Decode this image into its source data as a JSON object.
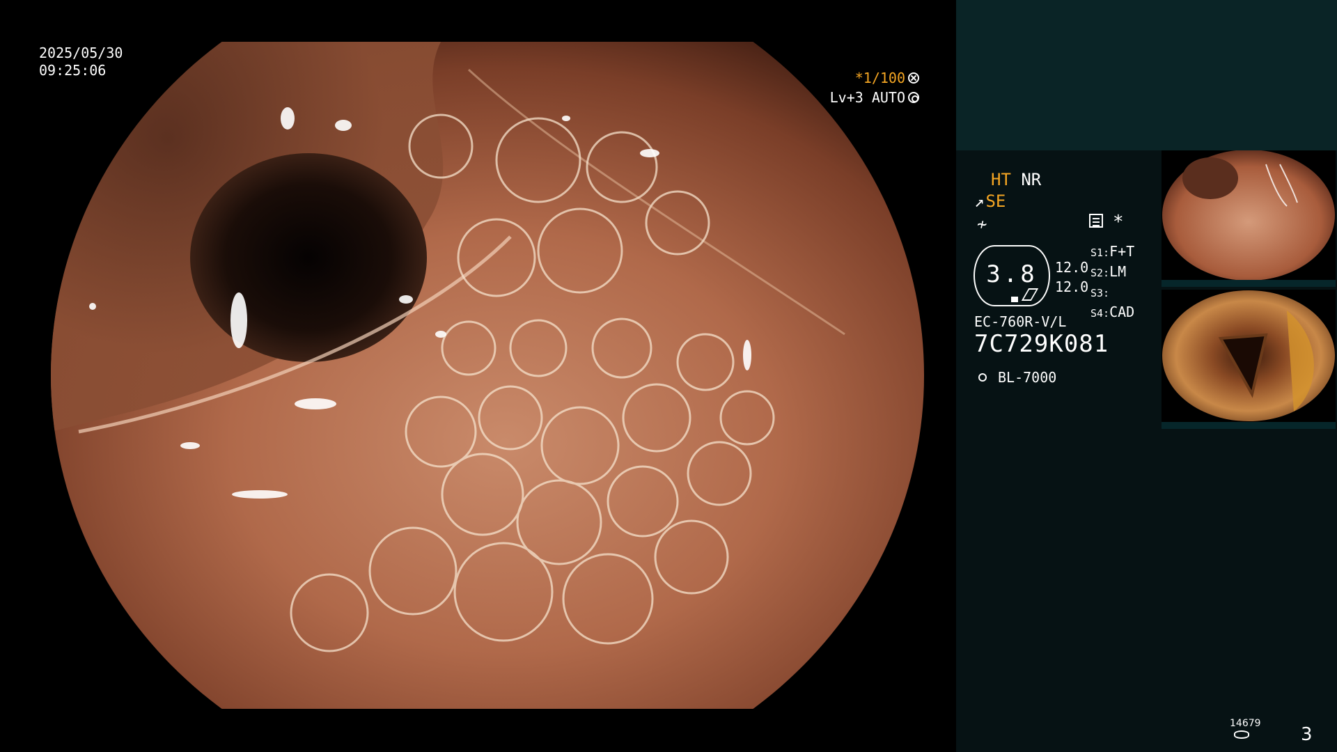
{
  "overlay": {
    "date": "2025/05/30",
    "time": "09:25:06",
    "shutter": "*1/100",
    "exposure": "Lv+3 AUTO"
  },
  "panel": {
    "mode_ht": "HT",
    "mode_nr": "NR",
    "mode_se": "SE",
    "zoom_value": "3.8",
    "num1": "12.0",
    "num2": "12.0",
    "s1_key": "S1:",
    "s1_val": "F+T",
    "s2_key": "S2:",
    "s2_val": "LM",
    "s3_key": "S3:",
    "s3_val": "",
    "s4_key": "S4:",
    "s4_val": "CAD",
    "scope_model": "EC-760R-V/L",
    "scope_serial": "7C729K081",
    "light_source": "BL-7000",
    "image_counter": "14679",
    "page_number": "3"
  },
  "icons": [
    "aperture-icon",
    "iris-icon",
    "scope-angle-icon",
    "flat-icon",
    "processor-icon",
    "sun-icon",
    "drive-icon"
  ],
  "colors": {
    "accent": "#f5a623",
    "panel_bg": "#061214",
    "panel_top": "#0a2426"
  }
}
